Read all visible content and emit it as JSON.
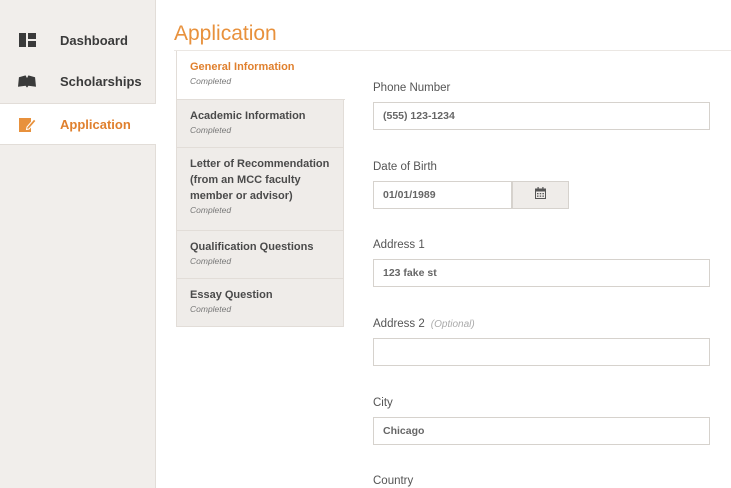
{
  "sidebar": {
    "items": [
      {
        "label": "Dashboard",
        "icon": "dashboard-icon"
      },
      {
        "label": "Scholarships",
        "icon": "book-icon"
      },
      {
        "label": "Application",
        "icon": "edit-icon"
      }
    ],
    "active": "Application"
  },
  "page": {
    "title": "Application"
  },
  "steps": [
    {
      "title": "General Information",
      "status": "Completed"
    },
    {
      "title": "Academic Information",
      "status": "Completed"
    },
    {
      "title": "Letter of Recommendation (from an MCC faculty member or advisor)",
      "status": "Completed"
    },
    {
      "title": "Qualification Questions",
      "status": "Completed"
    },
    {
      "title": "Essay Question",
      "status": "Completed"
    }
  ],
  "form": {
    "phone": {
      "label": "Phone Number",
      "value": "(555) 123-1234"
    },
    "dob": {
      "label": "Date of Birth",
      "value": "01/01/1989",
      "icon": "calendar-icon"
    },
    "address1": {
      "label": "Address 1",
      "value": "123 fake st"
    },
    "address2": {
      "label": "Address 2",
      "optional": "(Optional)",
      "value": ""
    },
    "city": {
      "label": "City",
      "value": "Chicago"
    },
    "country": {
      "label": "Country"
    }
  },
  "colors": {
    "accent": "#e0802e",
    "sidebar_bg": "#f1eeeb",
    "dark_icon": "#3a3a3a"
  }
}
